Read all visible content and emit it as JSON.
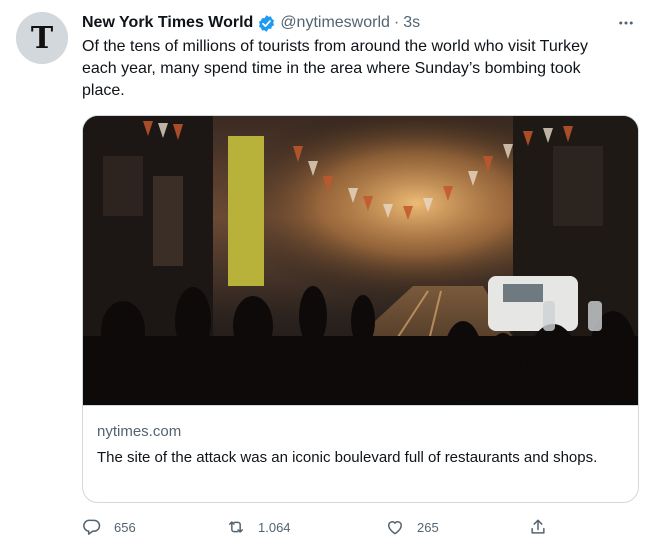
{
  "tweet": {
    "author_name": "New York Times World",
    "handle": "@nytimesworld",
    "separator": "·",
    "time": "3s",
    "avatar_letter": "T",
    "text": "Of the tens of millions of tourists from around the world who visit Turkey each year, many spend time in the area where Sunday’s bombing took place.",
    "card": {
      "domain": "nytimes.com",
      "title": "The site of the attack was an iconic boulevard full of restaurants and shops."
    },
    "actions": {
      "replies": "656",
      "retweets": "1.064",
      "likes": "265"
    },
    "icons": {
      "verified": "verified-badge-icon",
      "more": "more-icon",
      "reply": "reply-icon",
      "retweet": "retweet-icon",
      "like": "like-icon",
      "share": "share-icon"
    },
    "colors": {
      "verified_blue": "#1d9bf0",
      "secondary_text": "#536471",
      "primary_text": "#0f1419",
      "border": "#cfd9de"
    }
  }
}
